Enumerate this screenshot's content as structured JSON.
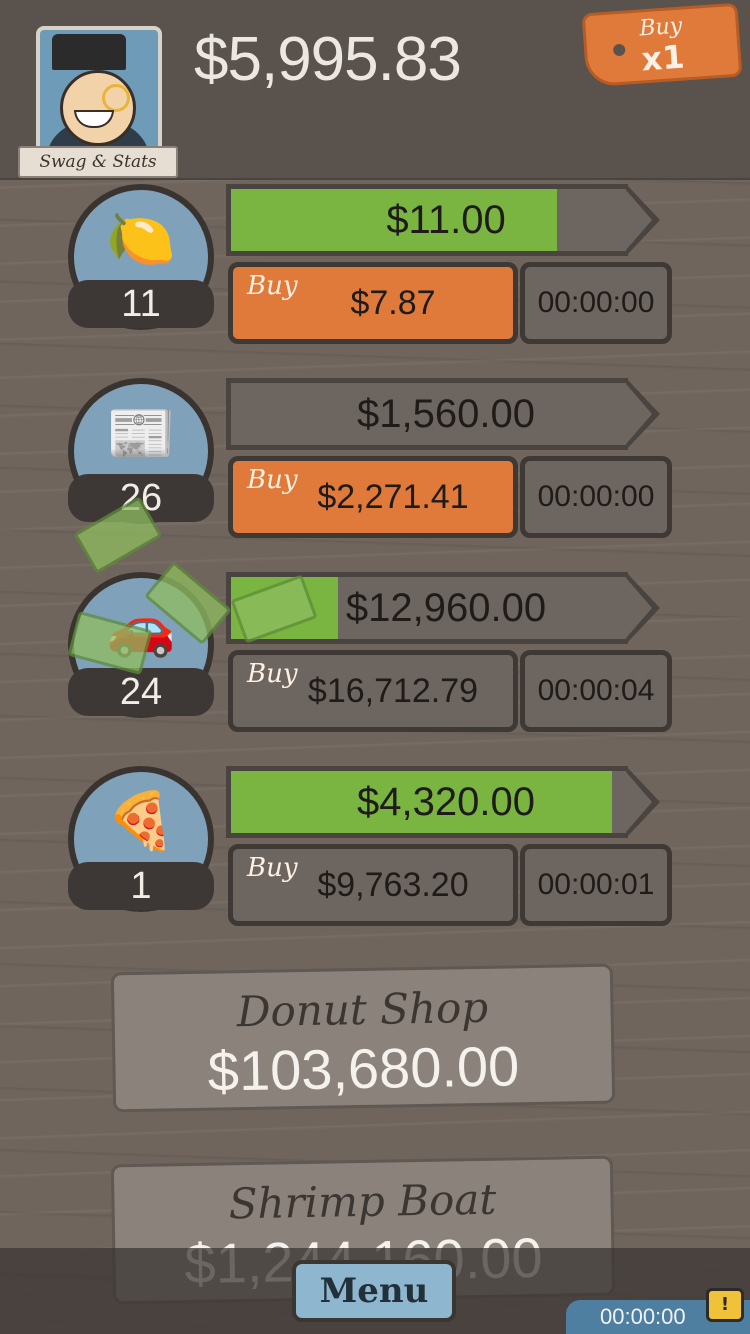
{
  "header": {
    "balance": "$5,995.83",
    "swag_label": "Swag & Stats",
    "buy_label": "Buy",
    "multiplier": "x1"
  },
  "businesses": [
    {
      "icon": "lemon-icon",
      "glyph": "🍋",
      "count": "11",
      "earnings": "$11.00",
      "progress": 0.82,
      "buy_label": "Buy",
      "cost": "$7.87",
      "timer": "00:00:00",
      "affordable": true
    },
    {
      "icon": "newspaper-icon",
      "glyph": "📰",
      "count": "26",
      "earnings": "$1,560.00",
      "progress": 0.0,
      "buy_label": "Buy",
      "cost": "$2,271.41",
      "timer": "00:00:00",
      "affordable": true
    },
    {
      "icon": "car-wash-icon",
      "glyph": "🚗",
      "count": "24",
      "earnings": "$12,960.00",
      "progress": 0.27,
      "buy_label": "Buy",
      "cost": "$16,712.79",
      "timer": "00:00:04",
      "affordable": false
    },
    {
      "icon": "pizza-icon",
      "glyph": "🍕",
      "count": "1",
      "earnings": "$4,320.00",
      "progress": 0.96,
      "buy_label": "Buy",
      "cost": "$9,763.20",
      "timer": "00:00:01",
      "affordable": false
    }
  ],
  "locked": [
    {
      "name": "Donut Shop",
      "price": "$103,680.00"
    },
    {
      "name": "Shrimp Boat",
      "price": "$1,244,160.00"
    }
  ],
  "footer": {
    "menu_label": "Menu",
    "tv_timer": "00:00:00",
    "tv_badge": "!"
  }
}
